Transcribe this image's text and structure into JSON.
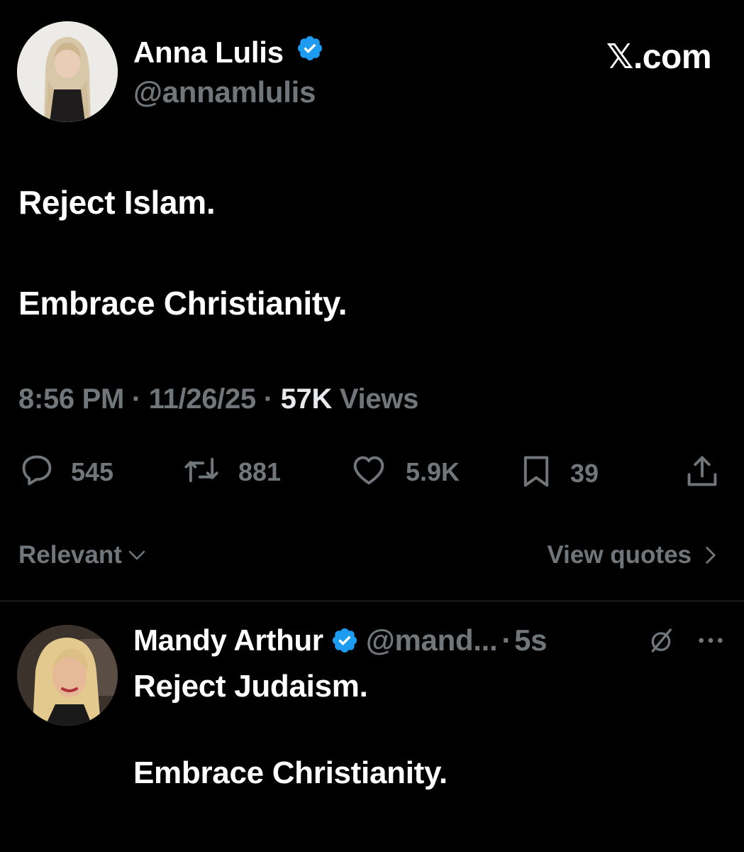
{
  "branding": {
    "site": "𝕏.com"
  },
  "main_tweet": {
    "author_name": "Anna Lulis",
    "author_handle": "@annamlulis",
    "verified": true,
    "text_line1": "Reject Islam.",
    "text_line2": "Embrace Christianity.",
    "time": "8:56 PM",
    "sep1": "·",
    "date": "11/26/25",
    "sep2": "·",
    "views_count": "57K",
    "views_label": "Views",
    "actions": {
      "replies": "545",
      "reposts": "881",
      "likes": "5.9K",
      "bookmarks": "39"
    },
    "sort_label": "Relevant",
    "view_quotes_label": "View quotes"
  },
  "reply_tweet": {
    "author_name": "Mandy Arthur",
    "author_handle": "@mand...",
    "sep": "·",
    "age": "5s",
    "verified": true,
    "text_line1": "Reject Judaism.",
    "text_line2": "Embrace Christianity."
  },
  "colors": {
    "background": "#000000",
    "text": "#ffffff",
    "muted": "#71767b",
    "verified_blue": "#1d9bf0",
    "divider": "#2f3336"
  }
}
